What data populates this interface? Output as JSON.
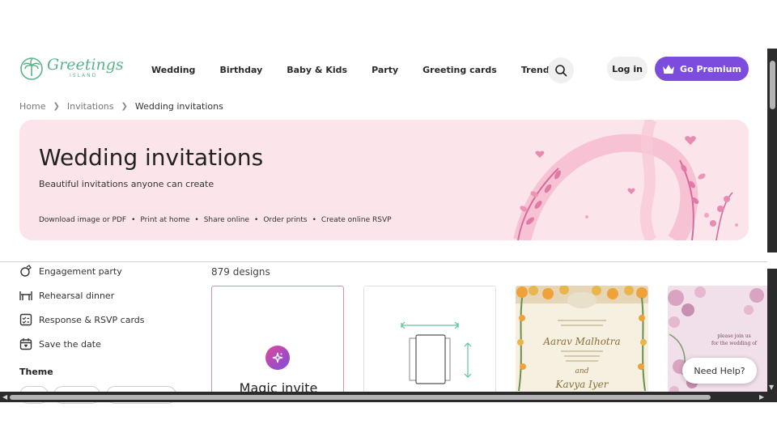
{
  "brand": {
    "name": "Greetings",
    "sub": "ISLAND"
  },
  "nav": [
    {
      "label": "Wedding"
    },
    {
      "label": "Birthday"
    },
    {
      "label": "Baby & Kids"
    },
    {
      "label": "Party"
    },
    {
      "label": "Greeting cards"
    },
    {
      "label": "Trending"
    }
  ],
  "header": {
    "login_label": "Log in",
    "premium_label": "Go Premium"
  },
  "breadcrumb": {
    "home": "Home",
    "invitations": "Invitations",
    "current": "Wedding invitations"
  },
  "hero": {
    "title": "Wedding invitations",
    "subtitle": "Beautiful invitations anyone can create",
    "features": [
      "Download image or PDF",
      "Print at home",
      "Share online",
      "Order prints",
      "Create online RSVP"
    ],
    "separator": "•"
  },
  "sidebar": {
    "items": [
      {
        "label": "Engagement party",
        "icon": "ring-icon"
      },
      {
        "label": "Rehearsal dinner",
        "icon": "table-icon"
      },
      {
        "label": "Response & RSVP cards",
        "icon": "rsvp-icon"
      },
      {
        "label": "Save the date",
        "icon": "calendar-icon"
      }
    ],
    "theme_label": "Theme"
  },
  "main": {
    "count_text": "879 designs",
    "magic_label": "Magic invite",
    "card1": {
      "name": "Aarav Malhotra",
      "amp": "and",
      "partner": "Kavya Iyer"
    },
    "card2": {
      "line1": "please join us",
      "line2": "for the wedding of"
    }
  },
  "help": {
    "label": "Need Help?"
  },
  "colors": {
    "accent": "#7b4cde",
    "hero_bg": "#fbe4ea",
    "brand_green": "#5cb38a",
    "floral_pink": "#e88bb2"
  }
}
